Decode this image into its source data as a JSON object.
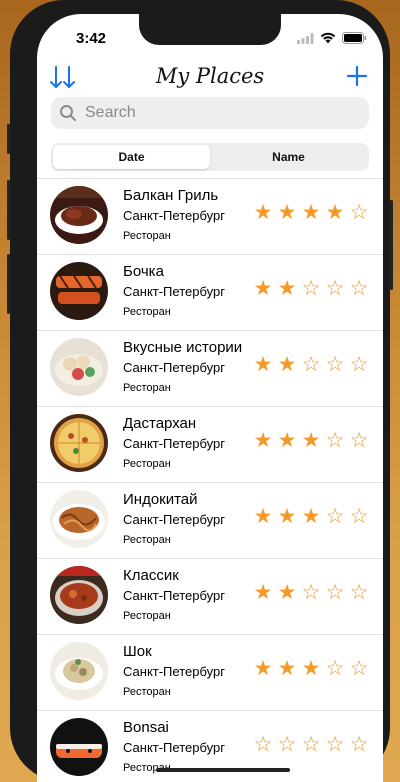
{
  "status_bar": {
    "time": "3:42"
  },
  "nav": {
    "title": "My Places"
  },
  "search": {
    "placeholder": "Search"
  },
  "segments": [
    "Date",
    "Name"
  ],
  "places": [
    {
      "name": "Балкан Гриль",
      "city": "Санкт-Петербург",
      "type": "Ресторан",
      "rating": 4,
      "image": "grill"
    },
    {
      "name": "Бочка",
      "city": "Санкт-Петербург",
      "type": "Ресторан",
      "rating": 2,
      "image": "fish"
    },
    {
      "name": "Вкусные истории",
      "city": "Санкт-Петербург",
      "type": "Ресторан",
      "rating": 2,
      "image": "dumplings"
    },
    {
      "name": "Дастархан",
      "city": "Санкт-Петербург",
      "type": "Ресторан",
      "rating": 3,
      "image": "pizza"
    },
    {
      "name": "Индокитай",
      "city": "Санкт-Петербург",
      "type": "Ресторан",
      "rating": 3,
      "image": "noodles"
    },
    {
      "name": "Классик",
      "city": "Санкт-Петербург",
      "type": "Ресторан",
      "rating": 2,
      "image": "soup"
    },
    {
      "name": "Шок",
      "city": "Санкт-Петербург",
      "type": "Ресторан",
      "rating": 3,
      "image": "salad"
    },
    {
      "name": "Bonsai",
      "city": "Санкт-Петербург",
      "type": "Ресторан",
      "rating": 0,
      "image": "sushi"
    }
  ],
  "colors": {
    "accent": "#1a73e8",
    "star": "#f09a2a"
  }
}
